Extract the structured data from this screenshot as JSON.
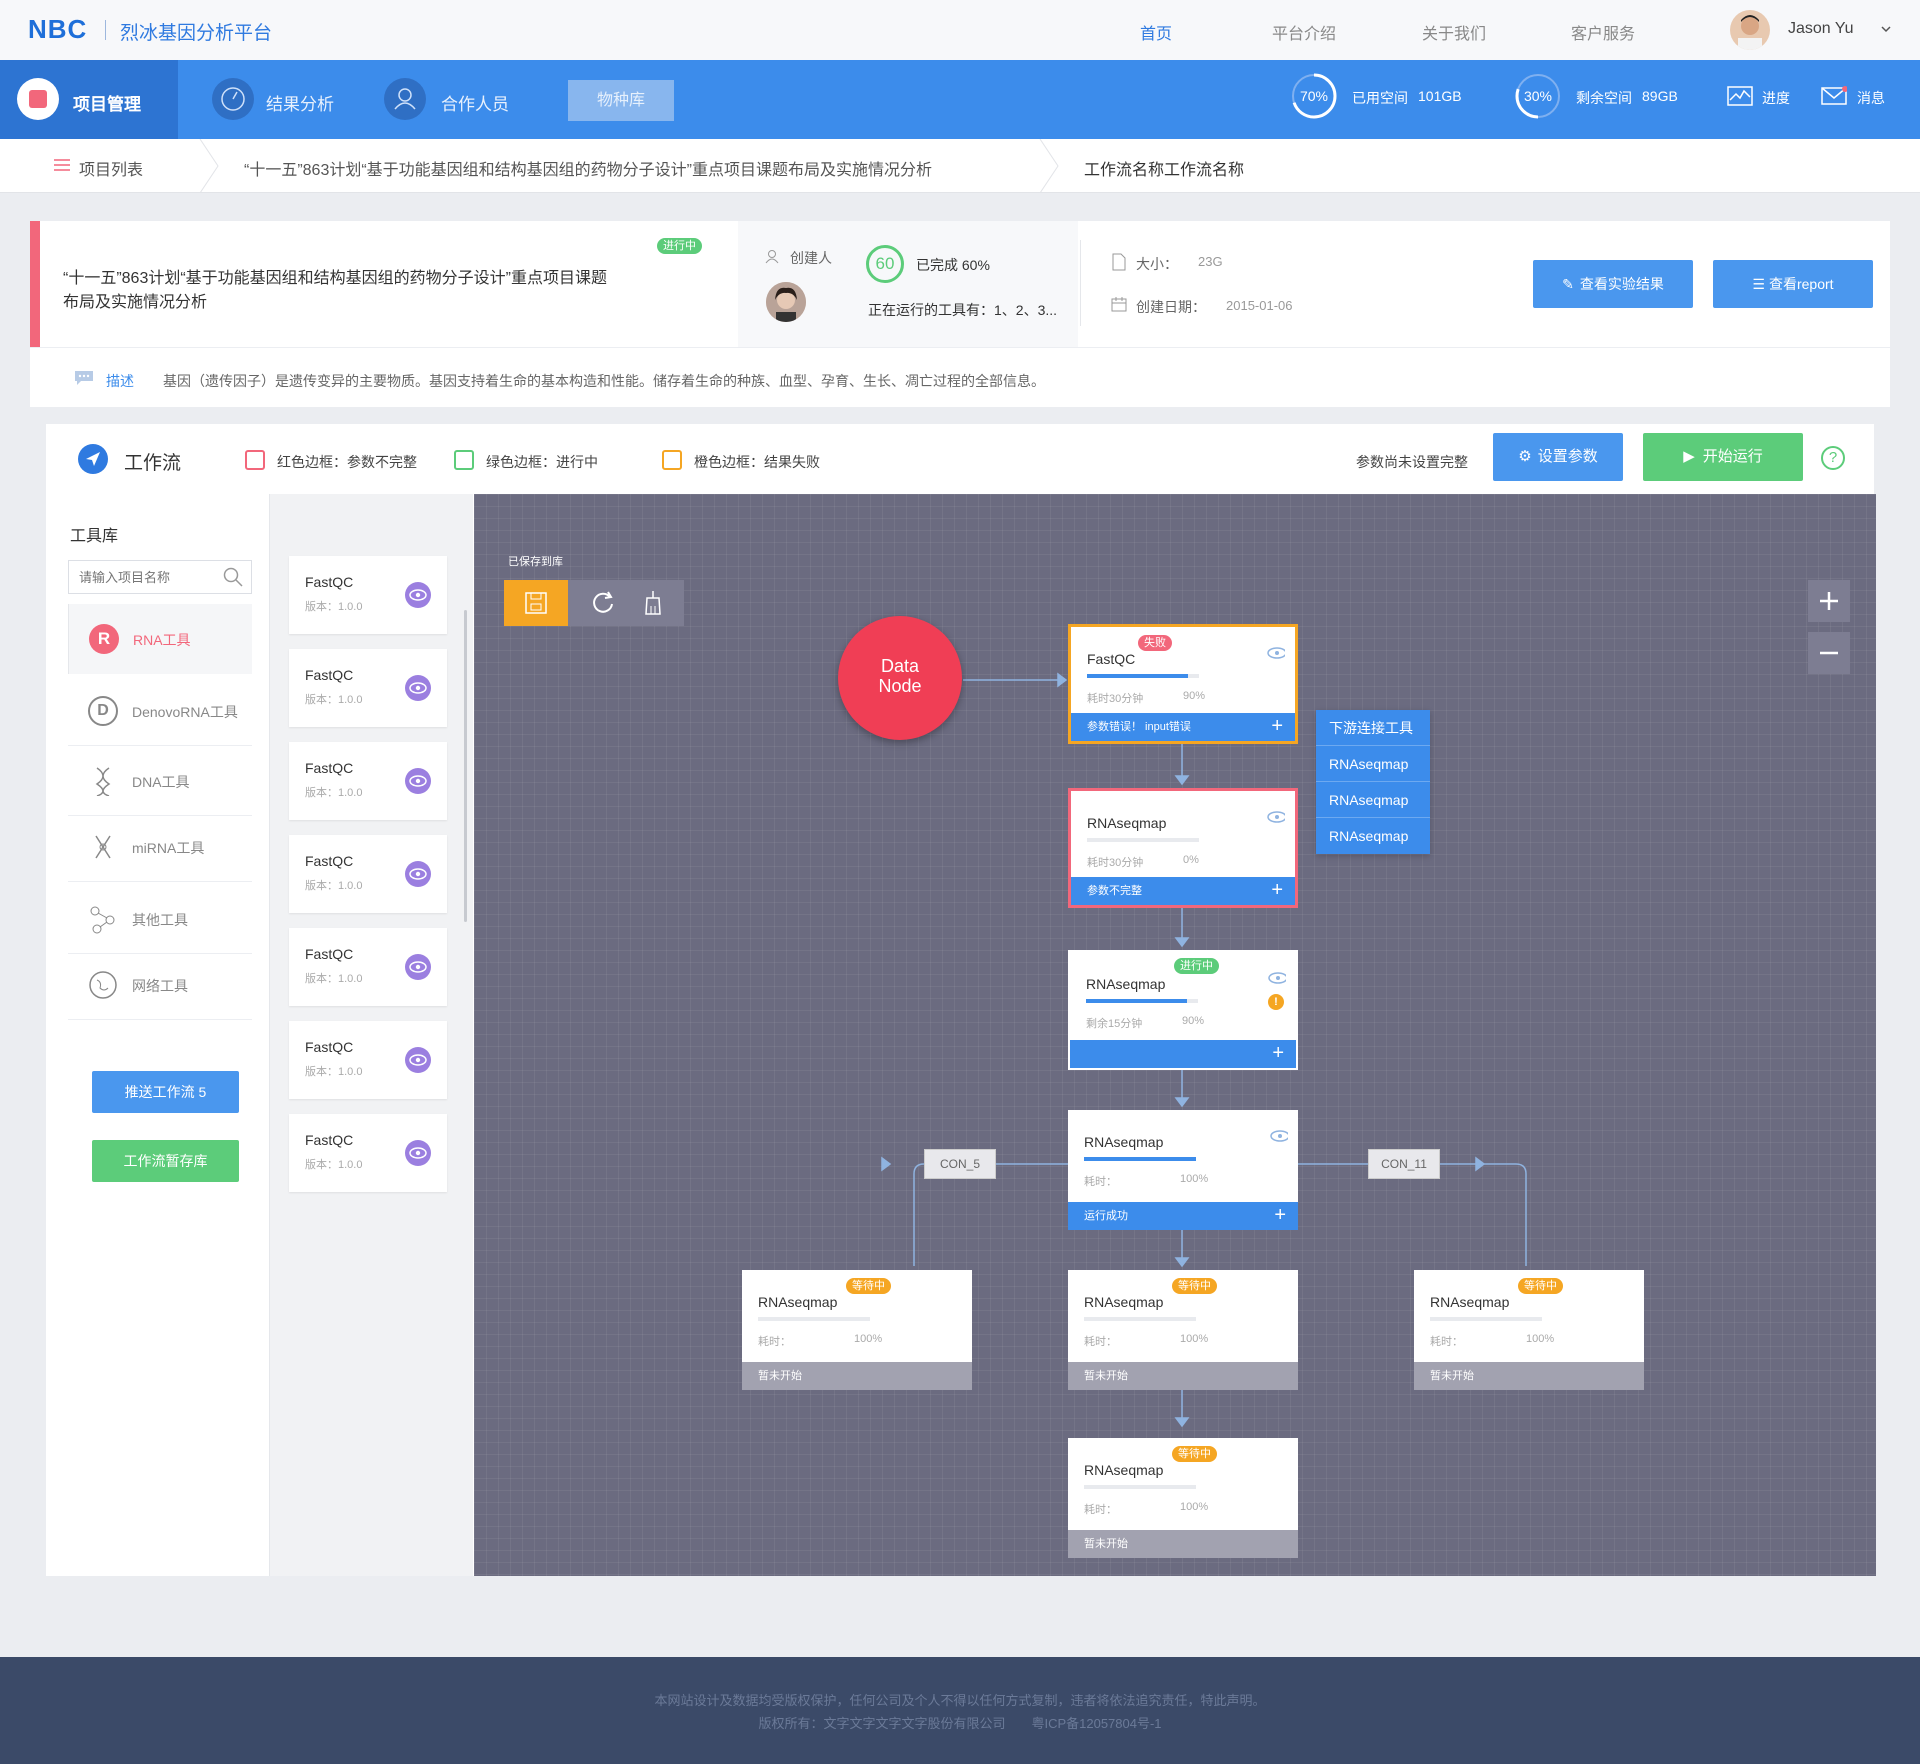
{
  "header": {
    "logo": "NBC",
    "platform_name": "烈冰基因分析平台",
    "nav": [
      "首页",
      "平台介绍",
      "关于我们",
      "客户服务"
    ],
    "user": "Jason Yu"
  },
  "mainnav": {
    "items": [
      "项目管理",
      "结果分析",
      "合作人员"
    ],
    "tab": "物种库",
    "used_pct": "70%",
    "used_label": "已用空间",
    "used_value": "101GB",
    "free_pct": "30%",
    "free_label": "剩余空间",
    "free_value": "89GB",
    "progress": "进度",
    "messages": "消息"
  },
  "breadcrumb": {
    "list": "项目列表",
    "project": "“十一五”863计划“基于功能基因组和结构基因组的药物分子设计”重点项目课题布局及实施情况分析",
    "workflow": "工作流名称工作流名称"
  },
  "project": {
    "status_tag": "进行中",
    "title_line1": "“十一五”863计划“基于功能基因组和结构基因组的药物分子设计”重点项目课题",
    "title_line2": "布局及实施情况分析",
    "creator_label": "创建人",
    "progress_num": "60",
    "progress_text": "已完成 60%",
    "running_tools": "正在运行的工具有：1、2、3...",
    "size_label": "大小：",
    "size_value": "23G",
    "date_label": "创建日期：",
    "date_value": "2015-01-06",
    "btn_results": "查看实验结果",
    "btn_report": "查看report",
    "desc_label": "描述",
    "desc_text": "基因（遗传因子）是遗传变异的主要物质。基因支持着生命的基本构造和性能。储存着生命的种族、血型、孕育、生长、凋亡过程的全部信息。"
  },
  "workflow": {
    "title": "工作流",
    "legend": [
      "红色边框：参数不完整",
      "绿色边框：进行中",
      "橙色边框：结果失败"
    ],
    "params_status": "参数尚未设置完整",
    "btn_params": "设置参数",
    "btn_run": "开始运行",
    "help": "?"
  },
  "library": {
    "title": "工具库",
    "search_placeholder": "请输入项目名称",
    "items": [
      "RNA工具",
      "DenovoRNA工具",
      "DNA工具",
      "miRNA工具",
      "其他工具",
      "网络工具"
    ],
    "btn_push": "推送工作流 5",
    "btn_save": "工作流暂存库"
  },
  "tools": [
    {
      "name": "FastQC",
      "version": "版本：1.0.0"
    },
    {
      "name": "FastQC",
      "version": "版本：1.0.0"
    },
    {
      "name": "FastQC",
      "version": "版本：1.0.0"
    },
    {
      "name": "FastQC",
      "version": "版本：1.0.0"
    },
    {
      "name": "FastQC",
      "version": "版本：1.0.0"
    },
    {
      "name": "FastQC",
      "version": "版本：1.0.0"
    },
    {
      "name": "FastQC",
      "version": "版本：1.0.0"
    }
  ],
  "canvas": {
    "saved_label": "已保存到库",
    "data_node": [
      "Data",
      "Node"
    ],
    "dropdown_title": "下游连接工具",
    "dropdown_items": [
      "RNAseqmap",
      "RNAseqmap",
      "RNAseqmap"
    ],
    "con_left": "CON_5",
    "con_right": "CON_11",
    "nodes": [
      {
        "title": "FastQC",
        "tag": "失败",
        "meta": "耗时30分钟",
        "pct": "90%",
        "footer": "参数错误！ input错误"
      },
      {
        "title": "RNAseqmap",
        "meta": "耗时30分钟",
        "pct": "0%",
        "footer": "参数不完整"
      },
      {
        "title": "RNAseqmap",
        "tag": "进行中",
        "meta": "剩余15分钟",
        "pct": "90%",
        "footer": ""
      },
      {
        "title": "RNAseqmap",
        "meta": "耗时：",
        "pct": "100%",
        "footer": "运行成功"
      },
      {
        "title": "RNAseqmap",
        "tag": "等待中",
        "meta": "耗时：",
        "pct": "100%",
        "footer": "暂未开始"
      },
      {
        "title": "RNAseqmap",
        "tag": "等待中",
        "meta": "耗时：",
        "pct": "100%",
        "footer": "暂未开始"
      },
      {
        "title": "RNAseqmap",
        "tag": "等待中",
        "meta": "耗时：",
        "pct": "100%",
        "footer": "暂未开始"
      },
      {
        "title": "RNAseqmap",
        "tag": "等待中",
        "meta": "耗时：",
        "pct": "100%",
        "footer": "暂未开始"
      }
    ]
  },
  "footer": {
    "line1": "本网站设计及数据均受版权保护，任何公司及个人不得以任何方式复制，违者将依法追究责任，特此声明。",
    "line2": "版权所有：文字文字文字文字股份有限公司　　粤ICP备12057804号-1"
  },
  "colors": {
    "primary": "#3c8ceb",
    "green": "#5ccc7a",
    "orange": "#f5a623",
    "red": "#f2677b",
    "canvas": "#6b6b80"
  }
}
